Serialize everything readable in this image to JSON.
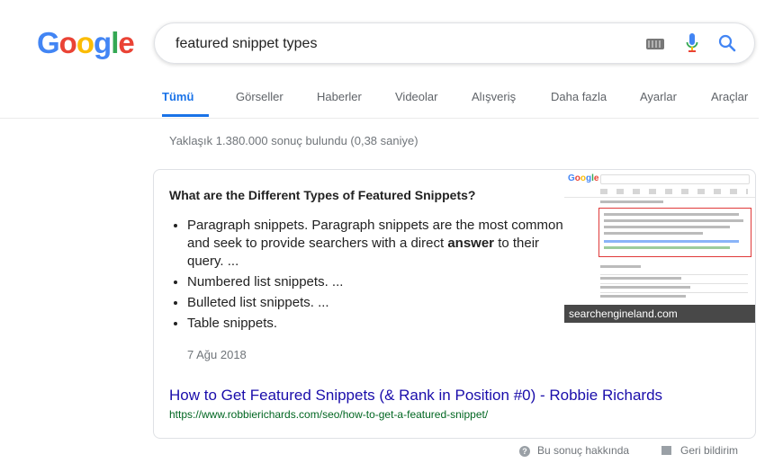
{
  "logo": {
    "G": "G",
    "o1": "o",
    "o2": "o",
    "g": "g",
    "l": "l",
    "e": "e"
  },
  "search": {
    "value": "featured snippet types"
  },
  "tabs": [
    {
      "label": "Tümü"
    },
    {
      "label": "Görseller"
    },
    {
      "label": "Haberler"
    },
    {
      "label": "Videolar"
    },
    {
      "label": "Alışveriş"
    },
    {
      "label": "Daha fazla"
    },
    {
      "label": "Ayarlar"
    },
    {
      "label": "Araçlar"
    }
  ],
  "stats": "Yaklaşık 1.380.000 sonuç bulundu (0,38 saniye)",
  "snippet": {
    "heading": "What are the Different Types of Featured Snippets?",
    "items": [
      {
        "pre": "Paragraph snippets. Paragraph snippets are the most common and seek to provide searchers with a direct ",
        "bold": "answer",
        "post": " to their query. ..."
      },
      {
        "text": "Numbered list snippets. ..."
      },
      {
        "text": "Bulleted list snippets. ..."
      },
      {
        "text": "Table snippets."
      }
    ],
    "date": "7 Ağu 2018",
    "result_title": "How to Get Featured Snippets (& Rank in Position #0) - Robbie Richards",
    "result_url": "https://www.robbierichards.com/seo/how-to-get-a-featured-snippet/",
    "image_caption": "searchengineland.com"
  },
  "footer": {
    "about": "Bu sonuç hakkında",
    "feedback": "Geri bildirim"
  }
}
